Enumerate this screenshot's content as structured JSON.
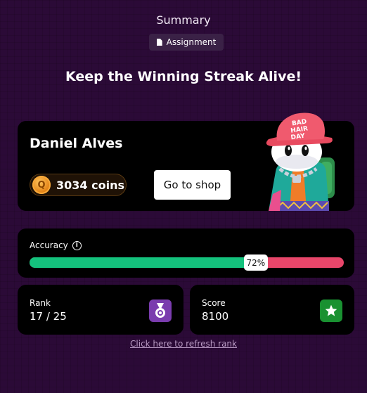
{
  "header": {
    "title": "Summary",
    "badge_label": "Assignment",
    "headline": "Keep the Winning Streak Alive!"
  },
  "profile": {
    "name": "Daniel Alves",
    "coins_label": "3034 coins",
    "shop_button_label": "Go to shop",
    "avatar_hat_text": [
      "BAD",
      "HAIR",
      "DAY"
    ]
  },
  "accuracy": {
    "label": "Accuracy",
    "percent_label": "72%",
    "fraction": 0.72,
    "colors": {
      "correct": "#14c27d",
      "incorrect": "#e8466a"
    }
  },
  "rank": {
    "label": "Rank",
    "value": "17 / 25",
    "icon": "medal-icon"
  },
  "score": {
    "label": "Score",
    "value": "8100",
    "icon": "star-icon"
  },
  "refresh_link": "Click here to refresh rank"
}
